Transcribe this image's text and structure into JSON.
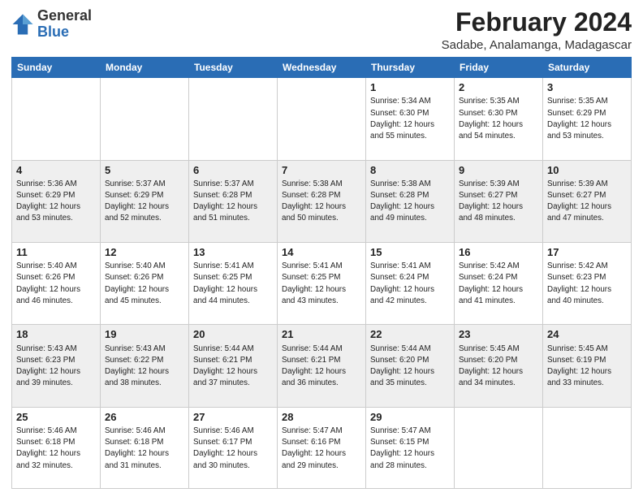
{
  "header": {
    "logo_general": "General",
    "logo_blue": "Blue",
    "month_year": "February 2024",
    "location": "Sadabe, Analamanga, Madagascar"
  },
  "days_of_week": [
    "Sunday",
    "Monday",
    "Tuesday",
    "Wednesday",
    "Thursday",
    "Friday",
    "Saturday"
  ],
  "weeks": [
    [
      {
        "day": "",
        "info": ""
      },
      {
        "day": "",
        "info": ""
      },
      {
        "day": "",
        "info": ""
      },
      {
        "day": "",
        "info": ""
      },
      {
        "day": "1",
        "info": "Sunrise: 5:34 AM\nSunset: 6:30 PM\nDaylight: 12 hours\nand 55 minutes."
      },
      {
        "day": "2",
        "info": "Sunrise: 5:35 AM\nSunset: 6:30 PM\nDaylight: 12 hours\nand 54 minutes."
      },
      {
        "day": "3",
        "info": "Sunrise: 5:35 AM\nSunset: 6:29 PM\nDaylight: 12 hours\nand 53 minutes."
      }
    ],
    [
      {
        "day": "4",
        "info": "Sunrise: 5:36 AM\nSunset: 6:29 PM\nDaylight: 12 hours\nand 53 minutes."
      },
      {
        "day": "5",
        "info": "Sunrise: 5:37 AM\nSunset: 6:29 PM\nDaylight: 12 hours\nand 52 minutes."
      },
      {
        "day": "6",
        "info": "Sunrise: 5:37 AM\nSunset: 6:28 PM\nDaylight: 12 hours\nand 51 minutes."
      },
      {
        "day": "7",
        "info": "Sunrise: 5:38 AM\nSunset: 6:28 PM\nDaylight: 12 hours\nand 50 minutes."
      },
      {
        "day": "8",
        "info": "Sunrise: 5:38 AM\nSunset: 6:28 PM\nDaylight: 12 hours\nand 49 minutes."
      },
      {
        "day": "9",
        "info": "Sunrise: 5:39 AM\nSunset: 6:27 PM\nDaylight: 12 hours\nand 48 minutes."
      },
      {
        "day": "10",
        "info": "Sunrise: 5:39 AM\nSunset: 6:27 PM\nDaylight: 12 hours\nand 47 minutes."
      }
    ],
    [
      {
        "day": "11",
        "info": "Sunrise: 5:40 AM\nSunset: 6:26 PM\nDaylight: 12 hours\nand 46 minutes."
      },
      {
        "day": "12",
        "info": "Sunrise: 5:40 AM\nSunset: 6:26 PM\nDaylight: 12 hours\nand 45 minutes."
      },
      {
        "day": "13",
        "info": "Sunrise: 5:41 AM\nSunset: 6:25 PM\nDaylight: 12 hours\nand 44 minutes."
      },
      {
        "day": "14",
        "info": "Sunrise: 5:41 AM\nSunset: 6:25 PM\nDaylight: 12 hours\nand 43 minutes."
      },
      {
        "day": "15",
        "info": "Sunrise: 5:41 AM\nSunset: 6:24 PM\nDaylight: 12 hours\nand 42 minutes."
      },
      {
        "day": "16",
        "info": "Sunrise: 5:42 AM\nSunset: 6:24 PM\nDaylight: 12 hours\nand 41 minutes."
      },
      {
        "day": "17",
        "info": "Sunrise: 5:42 AM\nSunset: 6:23 PM\nDaylight: 12 hours\nand 40 minutes."
      }
    ],
    [
      {
        "day": "18",
        "info": "Sunrise: 5:43 AM\nSunset: 6:23 PM\nDaylight: 12 hours\nand 39 minutes."
      },
      {
        "day": "19",
        "info": "Sunrise: 5:43 AM\nSunset: 6:22 PM\nDaylight: 12 hours\nand 38 minutes."
      },
      {
        "day": "20",
        "info": "Sunrise: 5:44 AM\nSunset: 6:21 PM\nDaylight: 12 hours\nand 37 minutes."
      },
      {
        "day": "21",
        "info": "Sunrise: 5:44 AM\nSunset: 6:21 PM\nDaylight: 12 hours\nand 36 minutes."
      },
      {
        "day": "22",
        "info": "Sunrise: 5:44 AM\nSunset: 6:20 PM\nDaylight: 12 hours\nand 35 minutes."
      },
      {
        "day": "23",
        "info": "Sunrise: 5:45 AM\nSunset: 6:20 PM\nDaylight: 12 hours\nand 34 minutes."
      },
      {
        "day": "24",
        "info": "Sunrise: 5:45 AM\nSunset: 6:19 PM\nDaylight: 12 hours\nand 33 minutes."
      }
    ],
    [
      {
        "day": "25",
        "info": "Sunrise: 5:46 AM\nSunset: 6:18 PM\nDaylight: 12 hours\nand 32 minutes."
      },
      {
        "day": "26",
        "info": "Sunrise: 5:46 AM\nSunset: 6:18 PM\nDaylight: 12 hours\nand 31 minutes."
      },
      {
        "day": "27",
        "info": "Sunrise: 5:46 AM\nSunset: 6:17 PM\nDaylight: 12 hours\nand 30 minutes."
      },
      {
        "day": "28",
        "info": "Sunrise: 5:47 AM\nSunset: 6:16 PM\nDaylight: 12 hours\nand 29 minutes."
      },
      {
        "day": "29",
        "info": "Sunrise: 5:47 AM\nSunset: 6:15 PM\nDaylight: 12 hours\nand 28 minutes."
      },
      {
        "day": "",
        "info": ""
      },
      {
        "day": "",
        "info": ""
      }
    ]
  ]
}
